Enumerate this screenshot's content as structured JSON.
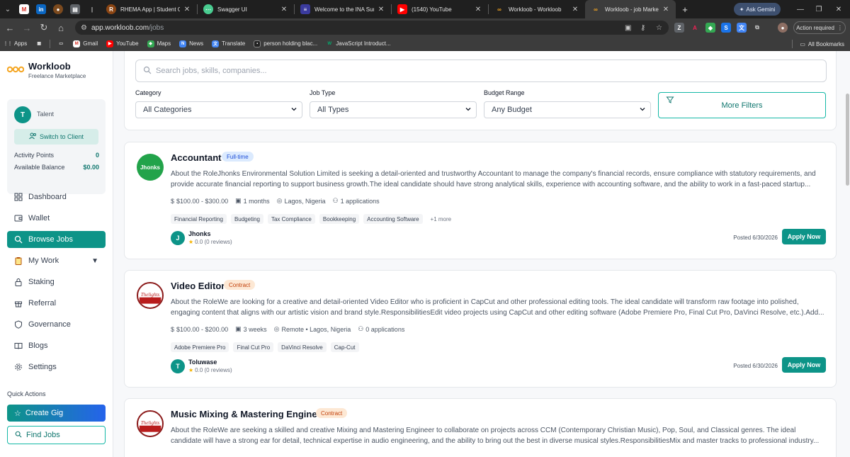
{
  "browser": {
    "tabs": [
      {
        "title": "RHEMA App | Student Cou",
        "favicon": "rhema"
      },
      {
        "title": "Swagger UI",
        "favicon": "swagger"
      },
      {
        "title": "Welcome to the INA Summ",
        "favicon": "ina"
      },
      {
        "title": "(1540) YouTube",
        "favicon": "youtube"
      },
      {
        "title": "Workloob - Workloob",
        "favicon": "workloob"
      },
      {
        "title": "Workloob - job Marketplac",
        "favicon": "workloob",
        "active": true
      }
    ],
    "ask_gemini": "Ask Gemini",
    "url_host": "app.workloob.com",
    "url_path": "/jobs",
    "action_required": "Action required",
    "bookmarks": [
      {
        "label": "Apps"
      },
      {
        "label": "Gmail"
      },
      {
        "label": "YouTube"
      },
      {
        "label": "Maps"
      },
      {
        "label": "News"
      },
      {
        "label": "Translate"
      },
      {
        "label": "person holding blac..."
      },
      {
        "label": "JavaScript Introduct..."
      }
    ],
    "all_bookmarks": "All Bookmarks"
  },
  "brand": {
    "name": "Workloob",
    "subtitle": "Freelance Marketplace"
  },
  "profile": {
    "initial": "T",
    "role": "Talent",
    "switch_label": "Switch to Client",
    "activity_points_label": "Activity Points",
    "activity_points": "0",
    "balance_label": "Available Balance",
    "balance": "$0.00"
  },
  "nav": [
    {
      "label": "Dashboard",
      "icon": "dashboard-icon"
    },
    {
      "label": "Wallet",
      "icon": "wallet-icon"
    },
    {
      "label": "Browse Jobs",
      "icon": "search-icon",
      "active": true
    },
    {
      "label": "My Work",
      "icon": "clipboard-icon",
      "has_caret": true
    },
    {
      "label": "Staking",
      "icon": "lock-icon"
    },
    {
      "label": "Referral",
      "icon": "gift-icon"
    },
    {
      "label": "Governance",
      "icon": "shield-icon"
    },
    {
      "label": "Blogs",
      "icon": "book-icon"
    },
    {
      "label": "Settings",
      "icon": "gear-icon"
    }
  ],
  "quick_actions": {
    "title": "Quick Actions",
    "create_gig": "Create Gig",
    "find_jobs": "Find Jobs"
  },
  "filters": {
    "search_placeholder": "Search jobs, skills, companies...",
    "category_label": "Category",
    "category_value": "All Categories",
    "job_type_label": "Job Type",
    "job_type_value": "All Types",
    "budget_label": "Budget Range",
    "budget_value": "Any Budget",
    "more_filters": "More Filters"
  },
  "jobs": [
    {
      "title": "Accountant",
      "badge": "Full-time",
      "badge_type": "full",
      "logo_text": "Jhonks",
      "description": "About the RoleJhonks Environmental Solution Limited is seeking a detail-oriented and trustworthy Accountant to manage the company's financial records, ensure compliance with statutory requirements, and provide accurate financial reporting to support business growth.The ideal candidate should have strong analytical skills, experience with accounting software, and the ability to work in a fast-paced startup...",
      "budget": "$100.00 - $300.00",
      "duration": "1 months",
      "location": "Lagos, Nigeria",
      "applications": "1 applications",
      "tags": [
        "Financial Reporting",
        "Budgeting",
        "Tax Compliance",
        "Bookkeeping",
        "Accounting Software"
      ],
      "more_tags": "+1 more",
      "poster_initial": "J",
      "poster_name": "Jhonks",
      "rating": "0.0 (0 reviews)",
      "posted": "Posted 6/30/2026",
      "apply": "Apply Now"
    },
    {
      "title": "Video Editor",
      "badge": "Contract",
      "badge_type": "contract",
      "logo_text": "Thelights",
      "description": "About the RoleWe are looking for a creative and detail-oriented Video Editor who is proficient in CapCut and other professional editing tools. The ideal candidate will transform raw footage into polished, engaging content that aligns with our artistic vision and brand style.ResponsibilitiesEdit video projects using CapCut and other editing software (Adobe Premiere Pro, Final Cut Pro, DaVinci Resolve, etc.).Add...",
      "budget": "$100.00 - $200.00",
      "duration": "3 weeks",
      "location": "Remote • Lagos, Nigeria",
      "applications": "0 applications",
      "tags": [
        "Adobe Premiere Pro",
        "Final Cut Pro",
        "DaVinci Resolve",
        "Cap-Cut"
      ],
      "more_tags": "",
      "poster_initial": "T",
      "poster_name": "Toluwase",
      "rating": "0.0 (0 reviews)",
      "posted": "Posted 6/30/2026",
      "apply": "Apply Now"
    },
    {
      "title": "Music Mixing & Mastering Engineer",
      "badge": "Contract",
      "badge_type": "contract",
      "logo_text": "Thelights",
      "description": "About the RoleWe are seeking a skilled and creative Mixing and Mastering Engineer to collaborate on projects across CCM (Contemporary Christian Music), Pop, Soul, and Classical genres. The ideal candidate will have a strong ear for detail, technical expertise in audio engineering, and the ability to bring out the best in diverse musical styles.ResponsibilitiesMix and master tracks to professional industry..."
    }
  ],
  "colors": {
    "accent": "#0d9488",
    "accent_dark": "#0f766e",
    "gradient_end": "#2563eb"
  }
}
